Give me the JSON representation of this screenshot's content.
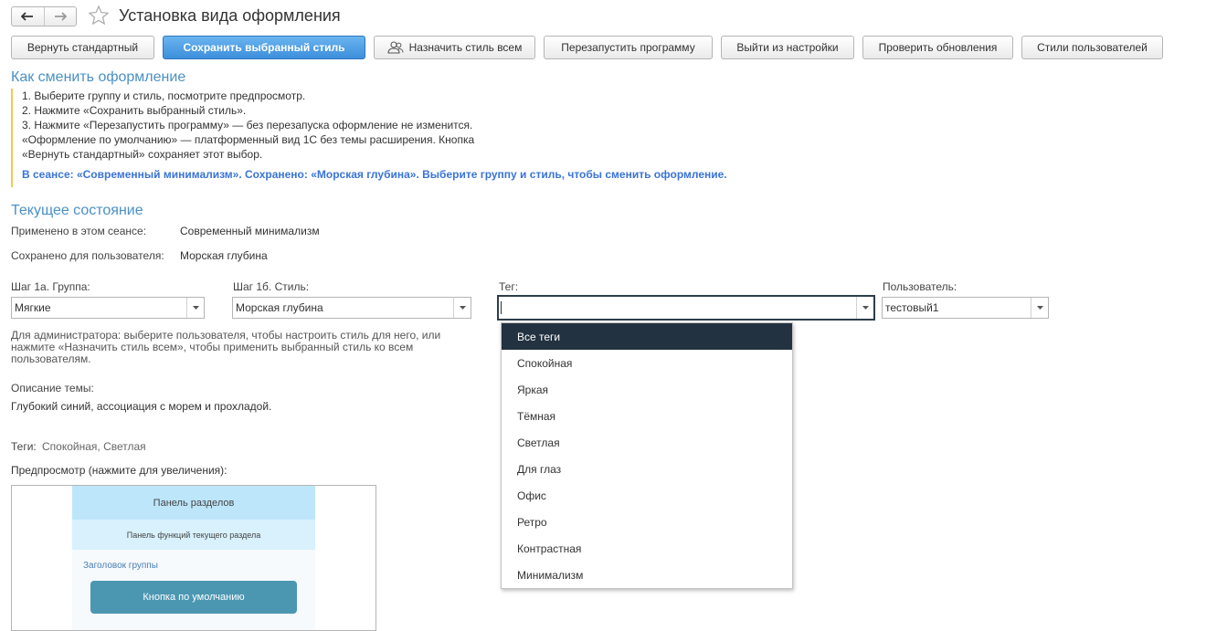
{
  "window": {
    "title": "Установка вида оформления"
  },
  "toolbar": {
    "reset": "Вернуть стандартный",
    "save": "Сохранить выбранный стиль",
    "assign_all": "Назначить стиль всем",
    "restart": "Перезапустить программу",
    "exit_settings": "Выйти из настройки",
    "check_updates": "Проверить обновления",
    "user_styles": "Стили пользователей"
  },
  "howto": {
    "heading": "Как сменить оформление",
    "lines": [
      "1. Выберите группу и стиль, посмотрите предпросмотр.",
      "2. Нажмите «Сохранить выбранный стиль».",
      "3. Нажмите «Перезапустить программу» — без перезапуска оформление не изменится.",
      "«Оформление по умолчанию» — платформенный вид 1С без темы расширения. Кнопка",
      "«Вернуть стандартный» сохраняет этот выбор."
    ],
    "status": "В сеансе: «Современный минимализм». Сохранено: «Морская глубина». Выберите группу и стиль, чтобы сменить оформление."
  },
  "state": {
    "heading": "Текущее состояние",
    "applied_label": "Применено в этом сеансе:",
    "applied_value": "Современный минимализм",
    "saved_label": "Сохранено для пользователя:",
    "saved_value": "Морская глубина"
  },
  "fields": {
    "group": {
      "label": "Шаг 1а. Группа:",
      "value": "Мягкие"
    },
    "style": {
      "label": "Шаг 1б. Стиль:",
      "value": "Морская глубина"
    },
    "tag": {
      "label": "Тег:",
      "value": ""
    },
    "user": {
      "label": "Пользователь:",
      "value": "тестовый1"
    }
  },
  "admin_hint": "Для администратора: выберите пользователя, чтобы настроить стиль для него, или нажмите «Назначить стиль всем», чтобы применить выбранный стиль ко всем пользователям.",
  "description": {
    "label": "Описание темы:",
    "text": "Глубокий синий, ассоциация с морем и прохладой."
  },
  "tags": {
    "label": "Теги:",
    "value": "Спокойная, Светлая"
  },
  "preview": {
    "label": "Предпросмотр (нажмите для увеличения):",
    "sections_panel": "Панель разделов",
    "functions_panel": "Панель функций текущего раздела",
    "group_header": "Заголовок группы",
    "default_button": "Кнопка по умолчанию"
  },
  "tag_dropdown": {
    "selected_index": 0,
    "items": [
      "Все теги",
      "Спокойная",
      "Яркая",
      "Тёмная",
      "Светлая",
      "Для глаз",
      "Офис",
      "Ретро",
      "Контрастная",
      "Минимализм"
    ]
  },
  "colors": {
    "primary_button": "#3d8fdc",
    "heading": "#4a90c6",
    "status_text": "#3a74d6",
    "dropdown_selected": "#233240",
    "instruction_bar": "#f3c94a"
  }
}
